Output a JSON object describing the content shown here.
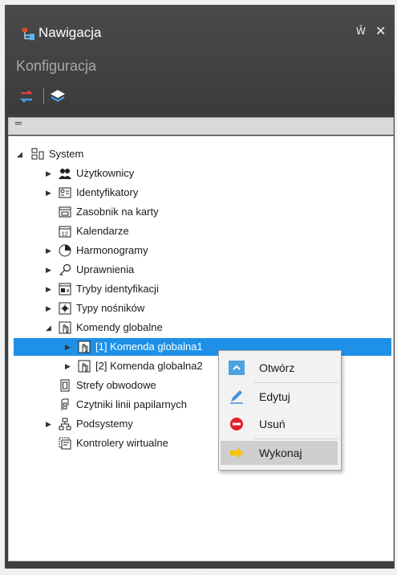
{
  "panel": {
    "title": "Nawigacja",
    "pin": "Ŵ",
    "close": "✕",
    "subtitle": "Konfiguracja",
    "collapse_glyph": "═",
    "grip": "......"
  },
  "tree": {
    "root": "System",
    "items": [
      {
        "label": "Użytkownicy",
        "icon": "users-icon"
      },
      {
        "label": "Identyfikatory",
        "icon": "id-card-icon"
      },
      {
        "label": "Zasobnik na karty",
        "icon": "card-tray-icon"
      },
      {
        "label": "Kalendarze",
        "icon": "calendar-icon"
      },
      {
        "label": "Harmonogramy",
        "icon": "clock-icon"
      },
      {
        "label": "Uprawnienia",
        "icon": "key-icon"
      },
      {
        "label": "Tryby identyfikacji",
        "icon": "mode-icon"
      },
      {
        "label": "Typy nośników",
        "icon": "media-type-icon"
      },
      {
        "label": "Komendy globalne",
        "icon": "command-icon"
      },
      {
        "label": "[1] Komenda globalna1",
        "icon": "command-icon"
      },
      {
        "label": "[2] Komenda globalna2",
        "icon": "command-icon"
      },
      {
        "label": "Strefy obwodowe",
        "icon": "zone-icon"
      },
      {
        "label": "Czytniki linii papilarnych",
        "icon": "fingerprint-reader-icon"
      },
      {
        "label": "Podsystemy",
        "icon": "subsystems-icon"
      },
      {
        "label": "Kontrolery wirtualne",
        "icon": "virtual-controller-icon"
      }
    ]
  },
  "context_menu": {
    "open": "Otwórz",
    "edit": "Edytuj",
    "delete": "Usuń",
    "execute": "Wykonaj"
  },
  "colors": {
    "selection": "#1e90e8",
    "header_bg": "#3f3f3f",
    "delete_red": "#e0202a",
    "execute_yellow": "#f5c400"
  }
}
